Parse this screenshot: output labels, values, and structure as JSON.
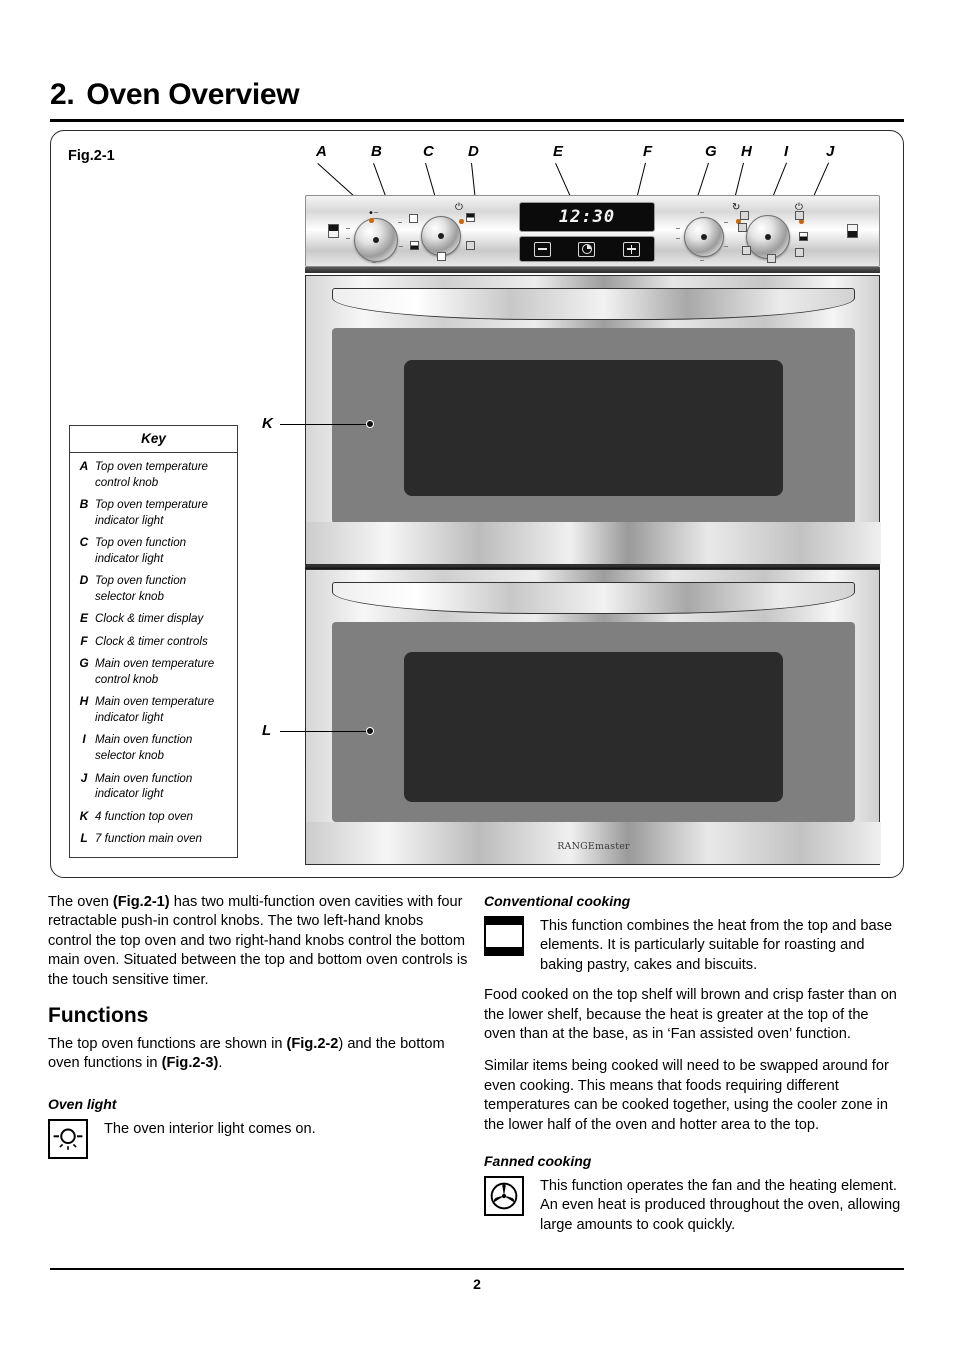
{
  "document": {
    "chapter_number": "2.",
    "chapter_title": "Oven Overview",
    "page_number": "2"
  },
  "figure": {
    "label": "Fig.2-1",
    "callouts_top": [
      "A",
      "B",
      "C",
      "D",
      "E",
      "F",
      "G",
      "H",
      "I",
      "J"
    ],
    "callout_top_oven": "K",
    "callout_main_oven": "L",
    "brand": "RANGEmaster",
    "timer_display_value": "12:30",
    "timer_buttons": [
      "minus-button",
      "clock-button",
      "plus-button"
    ]
  },
  "key": {
    "title": "Key",
    "items": [
      {
        "letter": "A",
        "text": "Top oven temperature control knob"
      },
      {
        "letter": "B",
        "text": "Top oven temperature indicator light"
      },
      {
        "letter": "C",
        "text": "Top oven function indicator light"
      },
      {
        "letter": "D",
        "text": "Top oven function selector knob"
      },
      {
        "letter": "E",
        "text": "Clock & timer display"
      },
      {
        "letter": "F",
        "text": "Clock & timer controls"
      },
      {
        "letter": "G",
        "text": "Main oven temperature control knob"
      },
      {
        "letter": "H",
        "text": "Main oven temperature indicator light"
      },
      {
        "letter": "I",
        "text": "Main oven function selector knob"
      },
      {
        "letter": "J",
        "text": "Main oven function indicator light"
      },
      {
        "letter": "K",
        "text": "4 function top oven"
      },
      {
        "letter": "L",
        "text": "7 function main oven"
      }
    ]
  },
  "left_column": {
    "intro_paragraph_1": "The oven ",
    "intro_bold_1": "(Fig.2-1)",
    "intro_paragraph_2": " has two multi-function oven cavities with four retractable push-in control knobs. The two left-hand knobs control the top oven and two right-hand knobs control the bottom main oven. Situated between the top and bottom oven controls is the touch sensitive timer.",
    "functions_heading": "Functions",
    "functions_text_1": "The top oven functions are shown in ",
    "functions_bold_1": "(Fig.2-2",
    "functions_text_2": ") and the bottom oven functions in ",
    "functions_bold_2": "(Fig.2-3)",
    "functions_text_3": ".",
    "oven_light_heading": "Oven light",
    "oven_light_text": "The oven interior light comes on."
  },
  "right_column": {
    "conventional_heading": "Conventional cooking",
    "conventional_text": "This function combines the heat from the top and base elements. It is particularly suitable for roasting and baking pastry, cakes and biscuits.",
    "conventional_para_2": "Food cooked on the top shelf will brown and crisp faster than on the lower shelf, because the heat is greater at the top of the oven than at the base, as in ‘Fan assisted oven’ function.",
    "conventional_para_3": "Similar items being cooked will need to be swapped around for even cooking. This means that foods requiring different temperatures can be cooked together, using the cooler zone in the lower half of the oven and hotter area to the top.",
    "fanned_heading": "Fanned cooking",
    "fanned_text": "This function operates the fan and the heating element. An even heat is produced throughout the oven, allowing large amounts to cook quickly."
  },
  "colors": {
    "text": "#000000",
    "indicator_light": "#c9690c",
    "oven_glass": "#2b2b2b",
    "glass_surround": "#7f7f7f",
    "display_background": "#0b0b0b"
  }
}
